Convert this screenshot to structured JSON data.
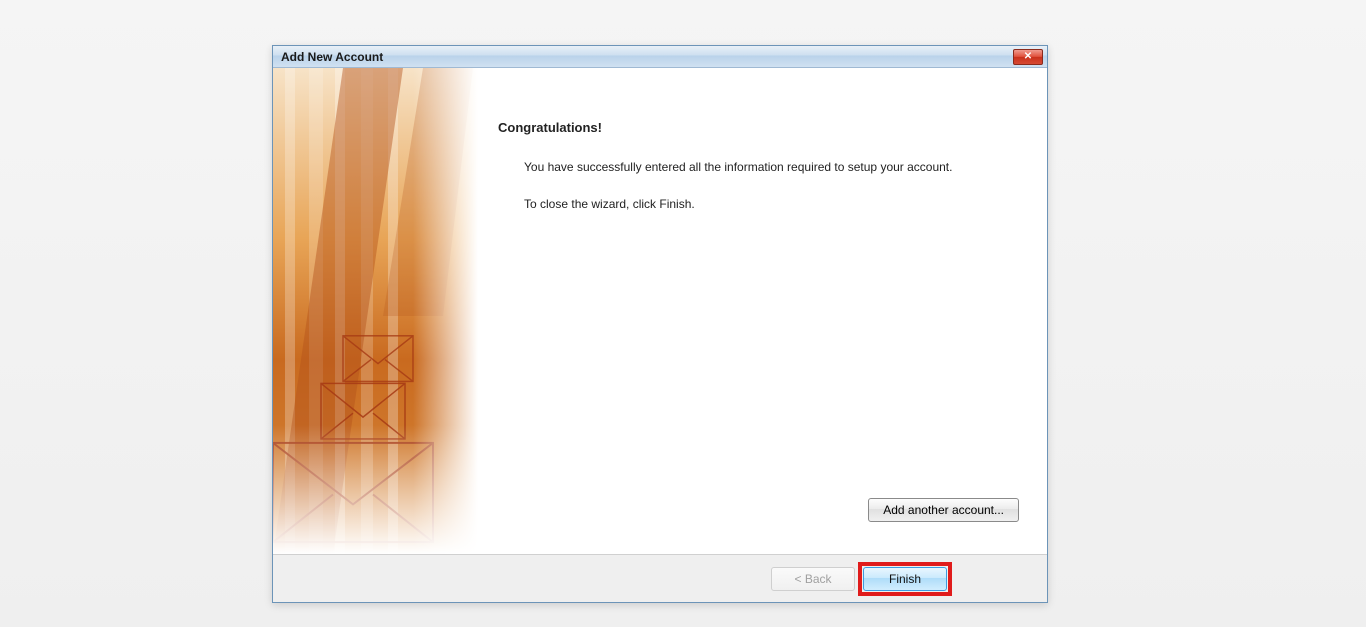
{
  "dialog": {
    "title": "Add New Account",
    "close_icon": "✕"
  },
  "content": {
    "heading": "Congratulations!",
    "line1": "You have successfully entered all the information required to setup your account.",
    "line2": "To close the wizard, click Finish.",
    "add_another_label": "Add another account..."
  },
  "buttons": {
    "back_label": "< Back",
    "finish_label": "Finish"
  }
}
